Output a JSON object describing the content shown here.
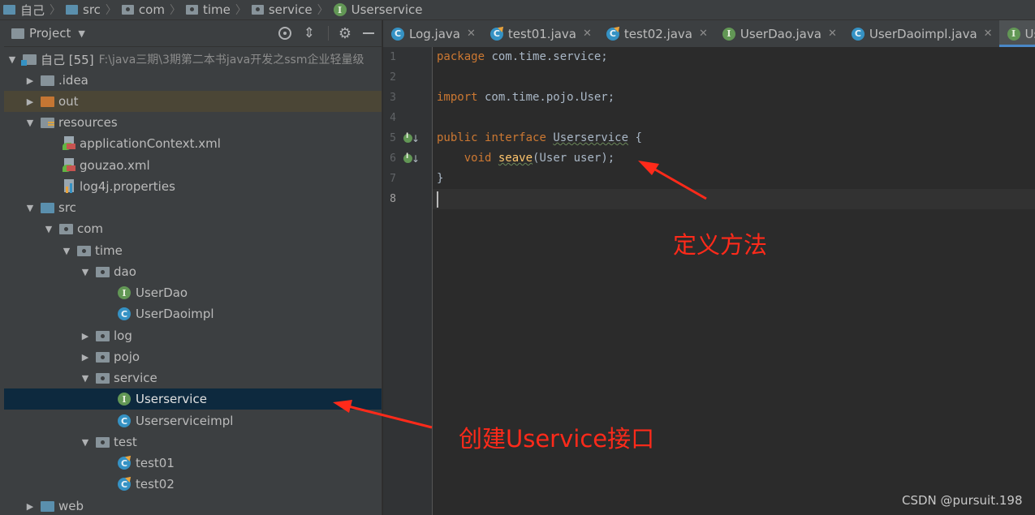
{
  "breadcrumb": [
    {
      "label": "自己",
      "icon": "module-folder-icon"
    },
    {
      "label": "src",
      "icon": "source-folder-icon"
    },
    {
      "label": "com",
      "icon": "package-icon"
    },
    {
      "label": "time",
      "icon": "package-icon"
    },
    {
      "label": "service",
      "icon": "package-icon"
    },
    {
      "label": "Userservice",
      "icon": "interface-icon"
    }
  ],
  "project_panel": {
    "title": "Project",
    "tools": [
      "locate-icon",
      "collapse-icon",
      "gear-icon",
      "minimize-icon"
    ]
  },
  "tree": {
    "root": {
      "label": "自己 [55]",
      "path": "F:\\java三期\\3期第二本书java开发之ssm企业轻量级"
    },
    "items": [
      {
        "label": ".idea"
      },
      {
        "label": "out"
      },
      {
        "label": "resources"
      },
      {
        "label": "applicationContext.xml"
      },
      {
        "label": "gouzao.xml"
      },
      {
        "label": "log4j.properties"
      },
      {
        "label": "src"
      },
      {
        "label": "com"
      },
      {
        "label": "time"
      },
      {
        "label": "dao"
      },
      {
        "label": "UserDao"
      },
      {
        "label": "UserDaoimpl"
      },
      {
        "label": "log"
      },
      {
        "label": "pojo"
      },
      {
        "label": "service"
      },
      {
        "label": "Userservice"
      },
      {
        "label": "Userserviceimpl"
      },
      {
        "label": "test"
      },
      {
        "label": "test01"
      },
      {
        "label": "test02"
      },
      {
        "label": "web"
      }
    ]
  },
  "tabs": [
    {
      "label": "Log.java",
      "icon": "class-icon"
    },
    {
      "label": "test01.java",
      "icon": "runnable-class-icon"
    },
    {
      "label": "test02.java",
      "icon": "runnable-class-icon"
    },
    {
      "label": "UserDao.java",
      "icon": "interface-icon"
    },
    {
      "label": "UserDaoimpl.java",
      "icon": "class-icon"
    },
    {
      "label": "Us",
      "icon": "interface-icon"
    }
  ],
  "editor": {
    "line_numbers": [
      "1",
      "2",
      "3",
      "4",
      "5",
      "6",
      "7",
      "8"
    ],
    "code": {
      "l1_kw": "package",
      "l1_rest": " com.time.service;",
      "l3_kw": "import",
      "l3_rest": " com.time.pojo.User;",
      "l5_kw1": "public",
      "l5_kw2": "interface",
      "l5_name": "Userservice",
      "l5_rest": " {",
      "l6_indent": "    ",
      "l6_kw": "void",
      "l6_fn": "seave",
      "l6_rest": "(User user);",
      "l7": "}"
    }
  },
  "annotations": {
    "define_method": "定义方法",
    "create_interface": "创建Uservice接口"
  },
  "watermark": "CSDN @pursuit.198",
  "colors": {
    "annotation": "#ff2a1a",
    "keyword": "#cc7832",
    "function": "#ffc66d",
    "selection": "#0d293e",
    "active_tab_underline": "#4a88c7"
  }
}
